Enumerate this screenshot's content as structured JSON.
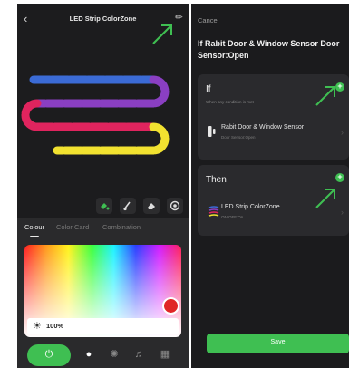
{
  "left_screen": {
    "title": "LED Strip ColorZone",
    "back_icon": "chevron-left-icon",
    "edit_icon": "pencil-icon",
    "strip_colors": [
      "#3b6bd6",
      "#8a3fc2",
      "#e0245e",
      "#f2e230"
    ],
    "tools": [
      "paint-bucket-icon",
      "brush-icon",
      "eraser-icon",
      "color-wheel-icon"
    ],
    "tabs": {
      "colour": "Colour",
      "color_card": "Color Card",
      "combination": "Combination"
    },
    "brightness_value": "100%",
    "selected_color": "#e02626",
    "bottom_nav": [
      "power-icon",
      "bulb-icon",
      "palette-icon",
      "music-icon",
      "grid-icon"
    ]
  },
  "right_screen": {
    "cancel_label": "Cancel",
    "title": "If Rabit Door & Window Sensor Door Sensor:Open",
    "if_card": {
      "heading": "If",
      "subtitle": "When any condition is met~",
      "condition": {
        "title": "Rabit Door & Window Sensor",
        "subtitle": "Door Sensor:Open"
      }
    },
    "then_card": {
      "heading": "Then",
      "action": {
        "title": "LED Strip ColorZone",
        "subtitle": "ON/OFF:On"
      }
    },
    "save_label": "Save"
  },
  "accent_color": "#3fbf52",
  "annotation_color": "#3fbf52"
}
